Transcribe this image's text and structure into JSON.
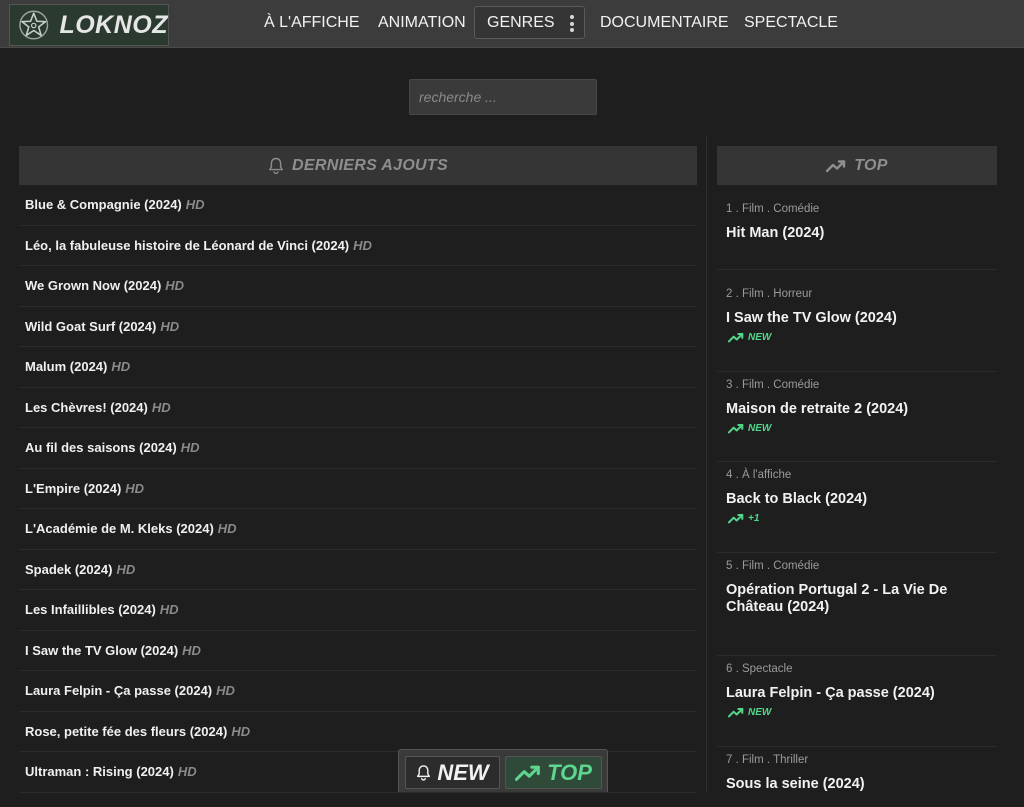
{
  "header": {
    "logo_text": "LOKNOZ",
    "nav": [
      {
        "label": "À L'AFFICHE"
      },
      {
        "label": "ANIMATION"
      },
      {
        "label": "GENRES"
      },
      {
        "label": "DOCUMENTAIRE"
      },
      {
        "label": "SPECTACLE"
      }
    ]
  },
  "search": {
    "placeholder": "recherche ..."
  },
  "latest": {
    "heading": "DERNIERS AJOUTS",
    "icon": "bell-icon",
    "items": [
      {
        "title": "Blue & Compagnie (2024)",
        "quality": "HD"
      },
      {
        "title": "Léo, la fabuleuse histoire de Léonard de Vinci (2024)",
        "quality": "HD"
      },
      {
        "title": "We Grown Now (2024)",
        "quality": "HD"
      },
      {
        "title": "Wild Goat Surf (2024)",
        "quality": "HD"
      },
      {
        "title": "Malum (2024)",
        "quality": "HD"
      },
      {
        "title": "Les Chèvres! (2024)",
        "quality": "HD"
      },
      {
        "title": "Au fil des saisons (2024)",
        "quality": "HD"
      },
      {
        "title": "L'Empire (2024)",
        "quality": "HD"
      },
      {
        "title": "L'Académie de M. Kleks (2024)",
        "quality": "HD"
      },
      {
        "title": "Spadek (2024)",
        "quality": "HD"
      },
      {
        "title": "Les Infaillibles (2024)",
        "quality": "HD"
      },
      {
        "title": "I Saw the TV Glow (2024)",
        "quality": "HD"
      },
      {
        "title": "Laura Felpin - Ça passe (2024)",
        "quality": "HD"
      },
      {
        "title": "Rose, petite fée des fleurs (2024)",
        "quality": "HD"
      },
      {
        "title": "Ultraman : Rising (2024)",
        "quality": "HD"
      }
    ]
  },
  "top": {
    "heading": "TOP",
    "icon": "trending-up-icon",
    "items": [
      {
        "meta": "1 . Film . Comédie",
        "title": "Hit Man (2024)",
        "badge": ""
      },
      {
        "meta": "2 . Film . Horreur",
        "title": "I Saw the TV Glow (2024)",
        "badge": "NEW"
      },
      {
        "meta": "3 . Film . Comédie",
        "title": "Maison de retraite 2 (2024)",
        "badge": "NEW"
      },
      {
        "meta": "4 . À l'affiche",
        "title": "Back to Black (2024)",
        "badge": "+1"
      },
      {
        "meta": "5 . Film . Comédie",
        "title": "Opération Portugal 2 - La Vie De Château (2024)",
        "badge": ""
      },
      {
        "meta": "6 . Spectacle",
        "title": "Laura Felpin - Ça passe (2024)",
        "badge": "NEW"
      },
      {
        "meta": "7 . Film . Thriller",
        "title": "Sous la seine (2024)",
        "badge": ""
      }
    ]
  },
  "floating": {
    "new_label": "NEW",
    "top_label": "TOP"
  },
  "colors": {
    "accent_green": "#52d68a",
    "background": "#1e1e1e",
    "header": "#3c3c3c"
  }
}
